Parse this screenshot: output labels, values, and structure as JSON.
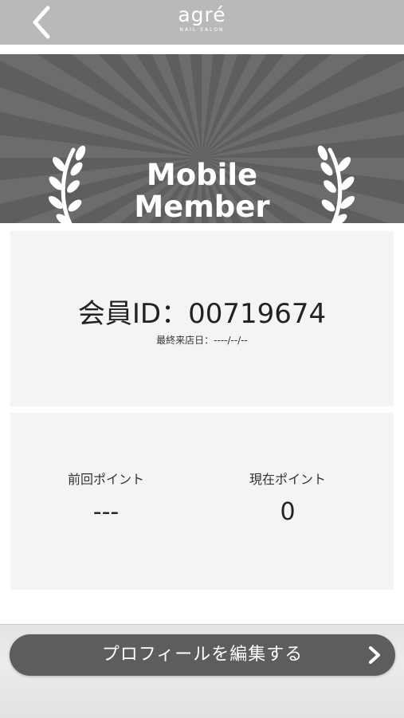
{
  "header": {
    "logo_main": "agré",
    "logo_sub": "NAIL SALON",
    "back_icon": "chevron-left-icon"
  },
  "banner": {
    "title_line1": "Mobile",
    "title_line2": "Member",
    "decoration_icon": "laurel-branch-icon"
  },
  "member": {
    "id_text": "会員ID：00719674",
    "last_visit": "最終来店日：----/--/--"
  },
  "points": {
    "previous_label": "前回ポイント",
    "previous_value": "---",
    "current_label": "現在ポイント",
    "current_value": "0"
  },
  "profile_button": {
    "label": "プロフィールを編集する",
    "icon": "chevron-right-icon"
  },
  "colors": {
    "header_bg": "#b9b9b9",
    "banner_bg": "#5e5e5e",
    "card_bg": "#f4f4f4",
    "button_bg": "#5d5d5d"
  }
}
